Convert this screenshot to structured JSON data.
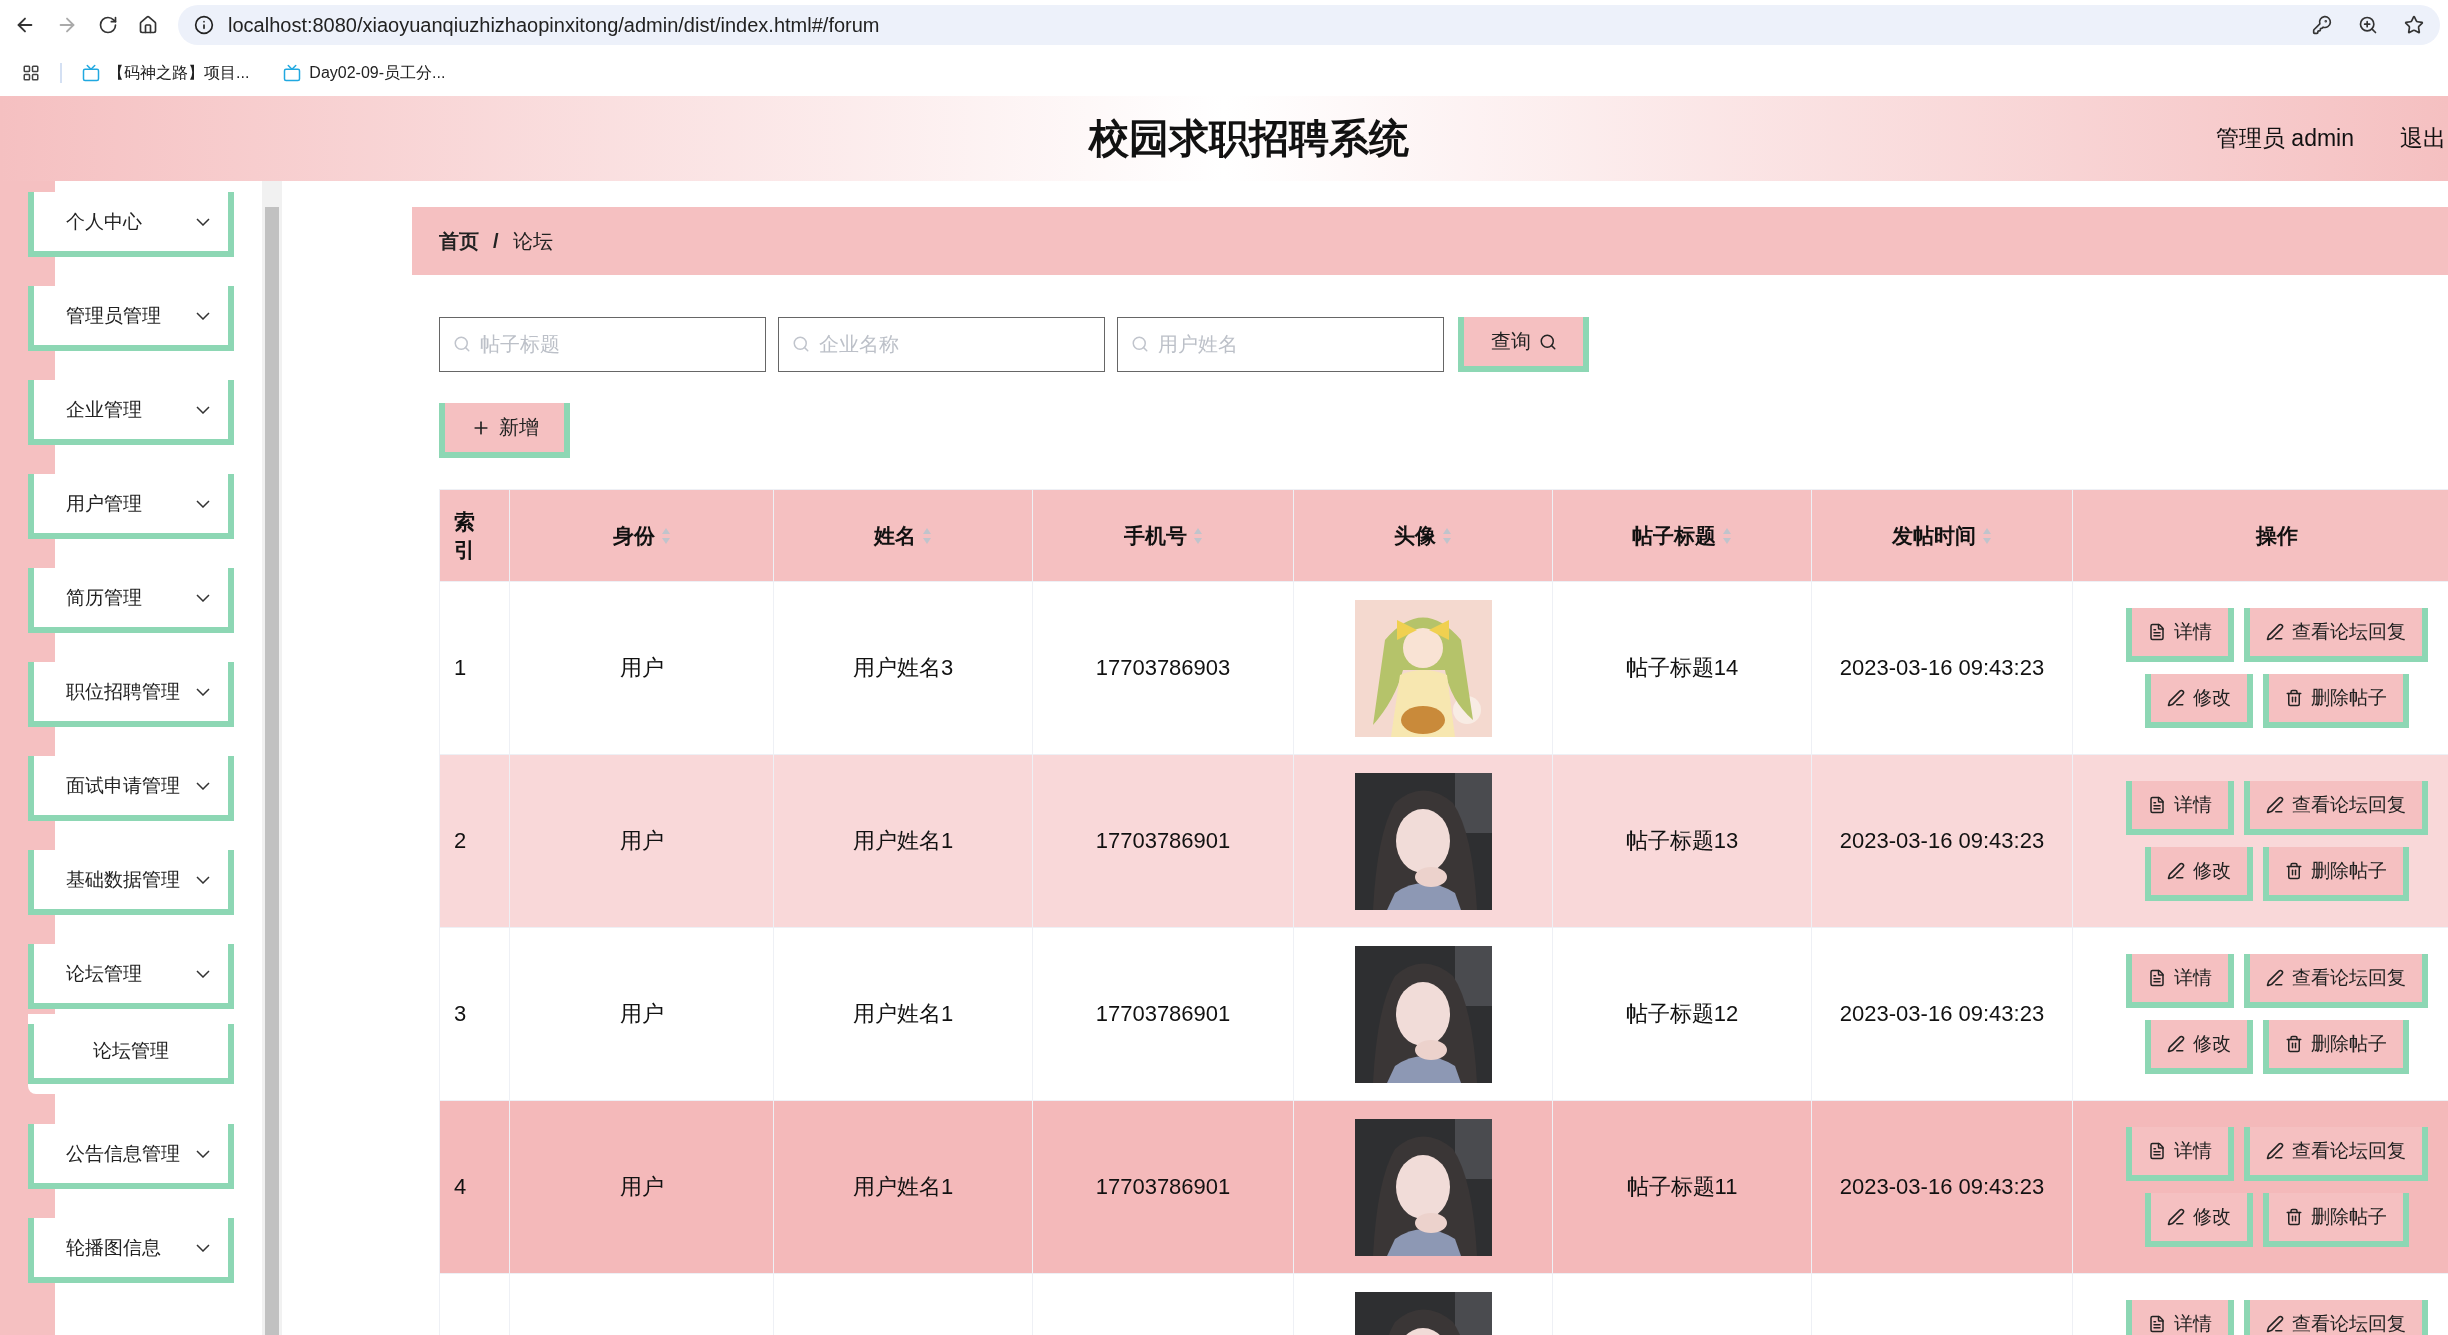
{
  "browser": {
    "url": "localhost:8080/xiaoyuanqiuzhizhaopinxitong/admin/dist/index.html#/forum",
    "bookmarks": [
      "【码神之路】项目...",
      "Day02-09-员工分..."
    ]
  },
  "header": {
    "title": "校园求职招聘系统",
    "user": "管理员 admin",
    "logout": "退出"
  },
  "sidebar": {
    "items": [
      {
        "label": "个人中心"
      },
      {
        "label": "管理员管理"
      },
      {
        "label": "企业管理"
      },
      {
        "label": "用户管理"
      },
      {
        "label": "简历管理"
      },
      {
        "label": "职位招聘管理"
      },
      {
        "label": "面试申请管理"
      },
      {
        "label": "基础数据管理"
      },
      {
        "label": "论坛管理",
        "children": [
          {
            "label": "论坛管理"
          }
        ]
      },
      {
        "label": "公告信息管理"
      },
      {
        "label": "轮播图信息"
      }
    ]
  },
  "breadcrumb": {
    "items": [
      "首页",
      "论坛"
    ],
    "separator": "/"
  },
  "search": {
    "fields": [
      {
        "placeholder": "帖子标题"
      },
      {
        "placeholder": "企业名称"
      },
      {
        "placeholder": "用户姓名"
      }
    ],
    "button": "查询"
  },
  "add_button": "新增",
  "table": {
    "columns": [
      {
        "label": "索引",
        "sortable": false
      },
      {
        "label": "身份",
        "sortable": true
      },
      {
        "label": "姓名",
        "sortable": true
      },
      {
        "label": "手机号",
        "sortable": true
      },
      {
        "label": "头像",
        "sortable": true
      },
      {
        "label": "帖子标题",
        "sortable": true
      },
      {
        "label": "发帖时间",
        "sortable": true
      },
      {
        "label": "操作",
        "sortable": false
      }
    ],
    "rows": [
      {
        "index": "1",
        "role": "用户",
        "name": "用户姓名3",
        "phone": "17703786903",
        "avatar": {
          "kind": "picture"
        },
        "title": "帖子标题14",
        "time": "2023-03-16 09:43:23",
        "hovered": false,
        "actions": [
          {
            "kind": "detail",
            "label": "详情"
          },
          {
            "kind": "replies",
            "label": "查看论坛回复"
          },
          {
            "kind": "edit",
            "label": "修改"
          },
          {
            "kind": "delete",
            "label": "删除帖子"
          }
        ]
      },
      {
        "index": "2",
        "role": "用户",
        "name": "用户姓名1",
        "phone": "17703786901",
        "avatar": {
          "kind": "picture"
        },
        "title": "帖子标题13",
        "time": "2023-03-16 09:43:23",
        "hovered": false,
        "actions": [
          {
            "kind": "detail",
            "label": "详情"
          },
          {
            "kind": "replies",
            "label": "查看论坛回复"
          },
          {
            "kind": "edit",
            "label": "修改"
          },
          {
            "kind": "delete",
            "label": "删除帖子"
          }
        ]
      },
      {
        "index": "3",
        "role": "用户",
        "name": "用户姓名1",
        "phone": "17703786901",
        "avatar": {
          "kind": "picture"
        },
        "title": "帖子标题12",
        "time": "2023-03-16 09:43:23",
        "hovered": false,
        "actions": [
          {
            "kind": "detail",
            "label": "详情"
          },
          {
            "kind": "replies",
            "label": "查看论坛回复"
          },
          {
            "kind": "edit",
            "label": "修改"
          },
          {
            "kind": "delete",
            "label": "删除帖子"
          }
        ]
      },
      {
        "index": "4",
        "role": "用户",
        "name": "用户姓名1",
        "phone": "17703786901",
        "avatar": {
          "kind": "picture"
        },
        "title": "帖子标题11",
        "time": "2023-03-16 09:43:23",
        "hovered": true,
        "actions": [
          {
            "kind": "detail",
            "label": "详情"
          },
          {
            "kind": "replies",
            "label": "查看论坛回复"
          },
          {
            "kind": "edit",
            "label": "修改"
          },
          {
            "kind": "delete",
            "label": "删除帖子"
          }
        ]
      },
      {
        "avatar": {
          "kind": "picture"
        },
        "hovered": false,
        "actions": [
          {
            "kind": "detail",
            "label": "详情"
          },
          {
            "kind": "replies",
            "label": "查看论坛回复"
          }
        ]
      }
    ]
  }
}
